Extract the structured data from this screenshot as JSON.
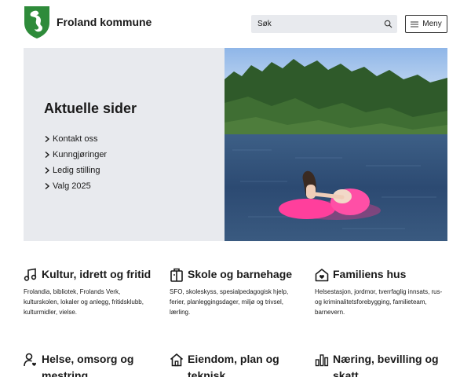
{
  "header": {
    "site_name": "Froland kommune",
    "search_placeholder": "Søk",
    "menu_label": "Meny",
    "logo_color": "#2e8b3a"
  },
  "hero": {
    "title": "Aktuelle sider",
    "links": [
      {
        "label": "Kontakt oss"
      },
      {
        "label": "Kunngjøringer"
      },
      {
        "label": "Ledig stilling"
      },
      {
        "label": "Valg 2025"
      }
    ]
  },
  "categories": [
    {
      "title": "Kultur, idrett og fritid",
      "icon": "music-note-icon",
      "description": "Frolandia, bibliotek, Frolands Verk, kulturskolen, lokaler og anlegg, fritidsklubb, kulturmidler, vielse."
    },
    {
      "title": "Skole og barnehage",
      "icon": "school-bag-icon",
      "description": "SFO, skoleskyss, spesialpedagogisk hjelp, ferier, planleggingsdager, miljø og trivsel, lærling."
    },
    {
      "title": "Familiens hus",
      "icon": "house-heart-icon",
      "description": "Helsestasjon, jordmor, tverrfaglig innsats, rus- og kriminalitetsforebygging, familieteam, barnevern."
    },
    {
      "title": "Helse, omsorg og mestring",
      "icon": "person-heart-icon",
      "description": ""
    },
    {
      "title": "Eiendom, plan og teknisk",
      "icon": "house-icon",
      "description": ""
    },
    {
      "title": "Næring, bevilling og skatt",
      "icon": "bar-chart-icon",
      "description": ""
    }
  ]
}
